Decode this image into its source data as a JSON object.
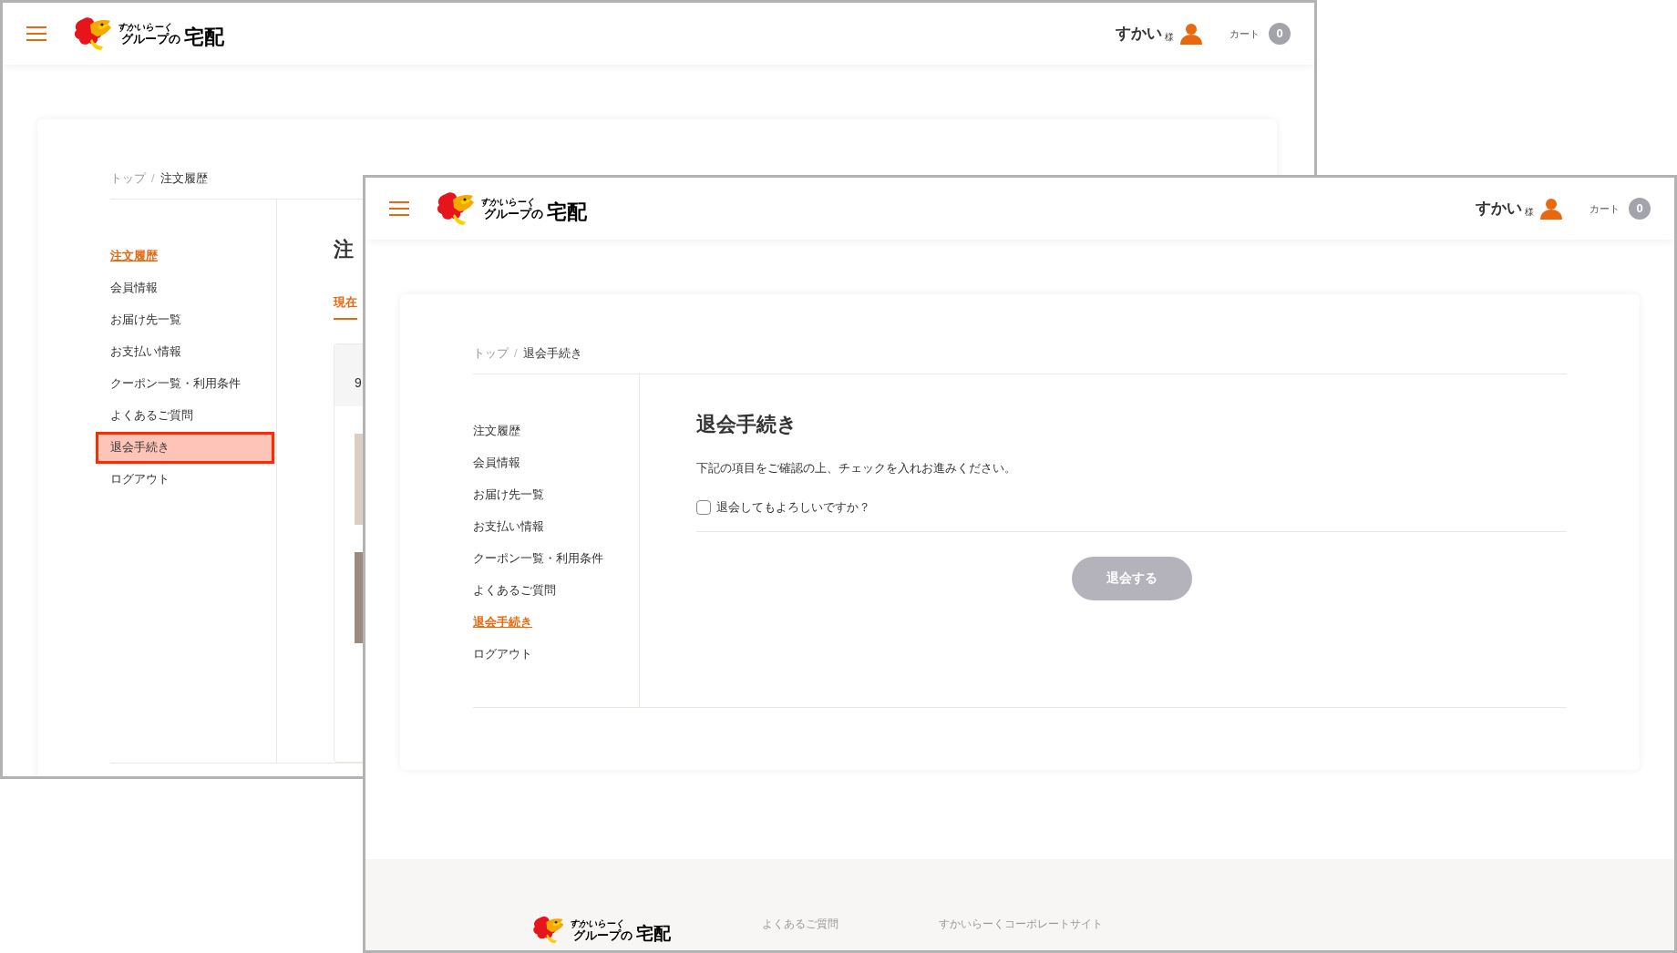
{
  "windows": [
    {
      "header": {
        "logo_top": "すかいらーく",
        "logo_bottom": "グループの",
        "logo_main": "宅配",
        "user_name": "すかい",
        "honorific": "様",
        "cart_label": "カート",
        "cart_count": "0"
      },
      "breadcrumb": [
        "トップ",
        "注文履歴"
      ],
      "breadcrumb_separator": "/",
      "sidebar": {
        "items": [
          {
            "label": "注文履歴",
            "selected": true,
            "annotated": false
          },
          {
            "label": "会員情報",
            "selected": false,
            "annotated": false
          },
          {
            "label": "お届け先一覧",
            "selected": false,
            "annotated": false
          },
          {
            "label": "お支払い情報",
            "selected": false,
            "annotated": false
          },
          {
            "label": "クーポン一覧・利用条件",
            "selected": false,
            "annotated": false
          },
          {
            "label": "よくあるご質問",
            "selected": false,
            "annotated": false
          },
          {
            "label": "退会手続き",
            "selected": false,
            "annotated": true
          },
          {
            "label": "ログアウト",
            "selected": false,
            "annotated": false
          }
        ]
      },
      "main": {
        "kind": "orders",
        "title": "注",
        "tabs": [
          {
            "label": "現在",
            "selected": true
          }
        ],
        "order_number": "9"
      }
    },
    {
      "header": {
        "logo_top": "すかいらーく",
        "logo_bottom": "グループの",
        "logo_main": "宅配",
        "user_name": "すかい",
        "honorific": "様",
        "cart_label": "カート",
        "cart_count": "0"
      },
      "breadcrumb": [
        "トップ",
        "退会手続き"
      ],
      "breadcrumb_separator": "/",
      "sidebar": {
        "items": [
          {
            "label": "注文履歴",
            "selected": false,
            "annotated": false
          },
          {
            "label": "会員情報",
            "selected": false,
            "annotated": false
          },
          {
            "label": "お届け先一覧",
            "selected": false,
            "annotated": false
          },
          {
            "label": "お支払い情報",
            "selected": false,
            "annotated": false
          },
          {
            "label": "クーポン一覧・利用条件",
            "selected": false,
            "annotated": false
          },
          {
            "label": "よくあるご質問",
            "selected": false,
            "annotated": false
          },
          {
            "label": "退会手続き",
            "selected": true,
            "annotated": false
          },
          {
            "label": "ログアウト",
            "selected": false,
            "annotated": false
          }
        ]
      },
      "main": {
        "kind": "withdraw",
        "title": "退会手続き",
        "instruction": "下記の項目をご確認の上、チェックを入れお進みください。",
        "checkbox": {
          "label": "退会してもよろしいですか？",
          "checked": false
        },
        "button": {
          "label": "退会する",
          "disabled": true
        }
      },
      "footer": {
        "logo_top": "すかいらーく",
        "logo_bottom": "グループの",
        "logo_main": "宅配",
        "links": [
          "よくあるご質問",
          "すかいらーくコーポレートサイト"
        ]
      }
    }
  ]
}
